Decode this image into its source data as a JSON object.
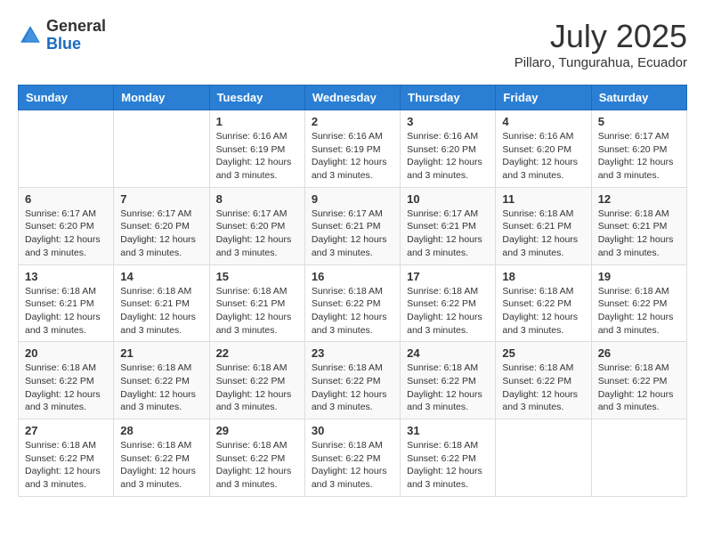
{
  "header": {
    "logo_general": "General",
    "logo_blue": "Blue",
    "month_year": "July 2025",
    "location": "Pillaro, Tungurahua, Ecuador"
  },
  "days_of_week": [
    "Sunday",
    "Monday",
    "Tuesday",
    "Wednesday",
    "Thursday",
    "Friday",
    "Saturday"
  ],
  "weeks": [
    [
      {
        "day": "",
        "info": ""
      },
      {
        "day": "",
        "info": ""
      },
      {
        "day": "1",
        "info": "Sunrise: 6:16 AM\nSunset: 6:19 PM\nDaylight: 12 hours and 3 minutes."
      },
      {
        "day": "2",
        "info": "Sunrise: 6:16 AM\nSunset: 6:19 PM\nDaylight: 12 hours and 3 minutes."
      },
      {
        "day": "3",
        "info": "Sunrise: 6:16 AM\nSunset: 6:20 PM\nDaylight: 12 hours and 3 minutes."
      },
      {
        "day": "4",
        "info": "Sunrise: 6:16 AM\nSunset: 6:20 PM\nDaylight: 12 hours and 3 minutes."
      },
      {
        "day": "5",
        "info": "Sunrise: 6:17 AM\nSunset: 6:20 PM\nDaylight: 12 hours and 3 minutes."
      }
    ],
    [
      {
        "day": "6",
        "info": "Sunrise: 6:17 AM\nSunset: 6:20 PM\nDaylight: 12 hours and 3 minutes."
      },
      {
        "day": "7",
        "info": "Sunrise: 6:17 AM\nSunset: 6:20 PM\nDaylight: 12 hours and 3 minutes."
      },
      {
        "day": "8",
        "info": "Sunrise: 6:17 AM\nSunset: 6:20 PM\nDaylight: 12 hours and 3 minutes."
      },
      {
        "day": "9",
        "info": "Sunrise: 6:17 AM\nSunset: 6:21 PM\nDaylight: 12 hours and 3 minutes."
      },
      {
        "day": "10",
        "info": "Sunrise: 6:17 AM\nSunset: 6:21 PM\nDaylight: 12 hours and 3 minutes."
      },
      {
        "day": "11",
        "info": "Sunrise: 6:18 AM\nSunset: 6:21 PM\nDaylight: 12 hours and 3 minutes."
      },
      {
        "day": "12",
        "info": "Sunrise: 6:18 AM\nSunset: 6:21 PM\nDaylight: 12 hours and 3 minutes."
      }
    ],
    [
      {
        "day": "13",
        "info": "Sunrise: 6:18 AM\nSunset: 6:21 PM\nDaylight: 12 hours and 3 minutes."
      },
      {
        "day": "14",
        "info": "Sunrise: 6:18 AM\nSunset: 6:21 PM\nDaylight: 12 hours and 3 minutes."
      },
      {
        "day": "15",
        "info": "Sunrise: 6:18 AM\nSunset: 6:21 PM\nDaylight: 12 hours and 3 minutes."
      },
      {
        "day": "16",
        "info": "Sunrise: 6:18 AM\nSunset: 6:22 PM\nDaylight: 12 hours and 3 minutes."
      },
      {
        "day": "17",
        "info": "Sunrise: 6:18 AM\nSunset: 6:22 PM\nDaylight: 12 hours and 3 minutes."
      },
      {
        "day": "18",
        "info": "Sunrise: 6:18 AM\nSunset: 6:22 PM\nDaylight: 12 hours and 3 minutes."
      },
      {
        "day": "19",
        "info": "Sunrise: 6:18 AM\nSunset: 6:22 PM\nDaylight: 12 hours and 3 minutes."
      }
    ],
    [
      {
        "day": "20",
        "info": "Sunrise: 6:18 AM\nSunset: 6:22 PM\nDaylight: 12 hours and 3 minutes."
      },
      {
        "day": "21",
        "info": "Sunrise: 6:18 AM\nSunset: 6:22 PM\nDaylight: 12 hours and 3 minutes."
      },
      {
        "day": "22",
        "info": "Sunrise: 6:18 AM\nSunset: 6:22 PM\nDaylight: 12 hours and 3 minutes."
      },
      {
        "day": "23",
        "info": "Sunrise: 6:18 AM\nSunset: 6:22 PM\nDaylight: 12 hours and 3 minutes."
      },
      {
        "day": "24",
        "info": "Sunrise: 6:18 AM\nSunset: 6:22 PM\nDaylight: 12 hours and 3 minutes."
      },
      {
        "day": "25",
        "info": "Sunrise: 6:18 AM\nSunset: 6:22 PM\nDaylight: 12 hours and 3 minutes."
      },
      {
        "day": "26",
        "info": "Sunrise: 6:18 AM\nSunset: 6:22 PM\nDaylight: 12 hours and 3 minutes."
      }
    ],
    [
      {
        "day": "27",
        "info": "Sunrise: 6:18 AM\nSunset: 6:22 PM\nDaylight: 12 hours and 3 minutes."
      },
      {
        "day": "28",
        "info": "Sunrise: 6:18 AM\nSunset: 6:22 PM\nDaylight: 12 hours and 3 minutes."
      },
      {
        "day": "29",
        "info": "Sunrise: 6:18 AM\nSunset: 6:22 PM\nDaylight: 12 hours and 3 minutes."
      },
      {
        "day": "30",
        "info": "Sunrise: 6:18 AM\nSunset: 6:22 PM\nDaylight: 12 hours and 3 minutes."
      },
      {
        "day": "31",
        "info": "Sunrise: 6:18 AM\nSunset: 6:22 PM\nDaylight: 12 hours and 3 minutes."
      },
      {
        "day": "",
        "info": ""
      },
      {
        "day": "",
        "info": ""
      }
    ]
  ]
}
